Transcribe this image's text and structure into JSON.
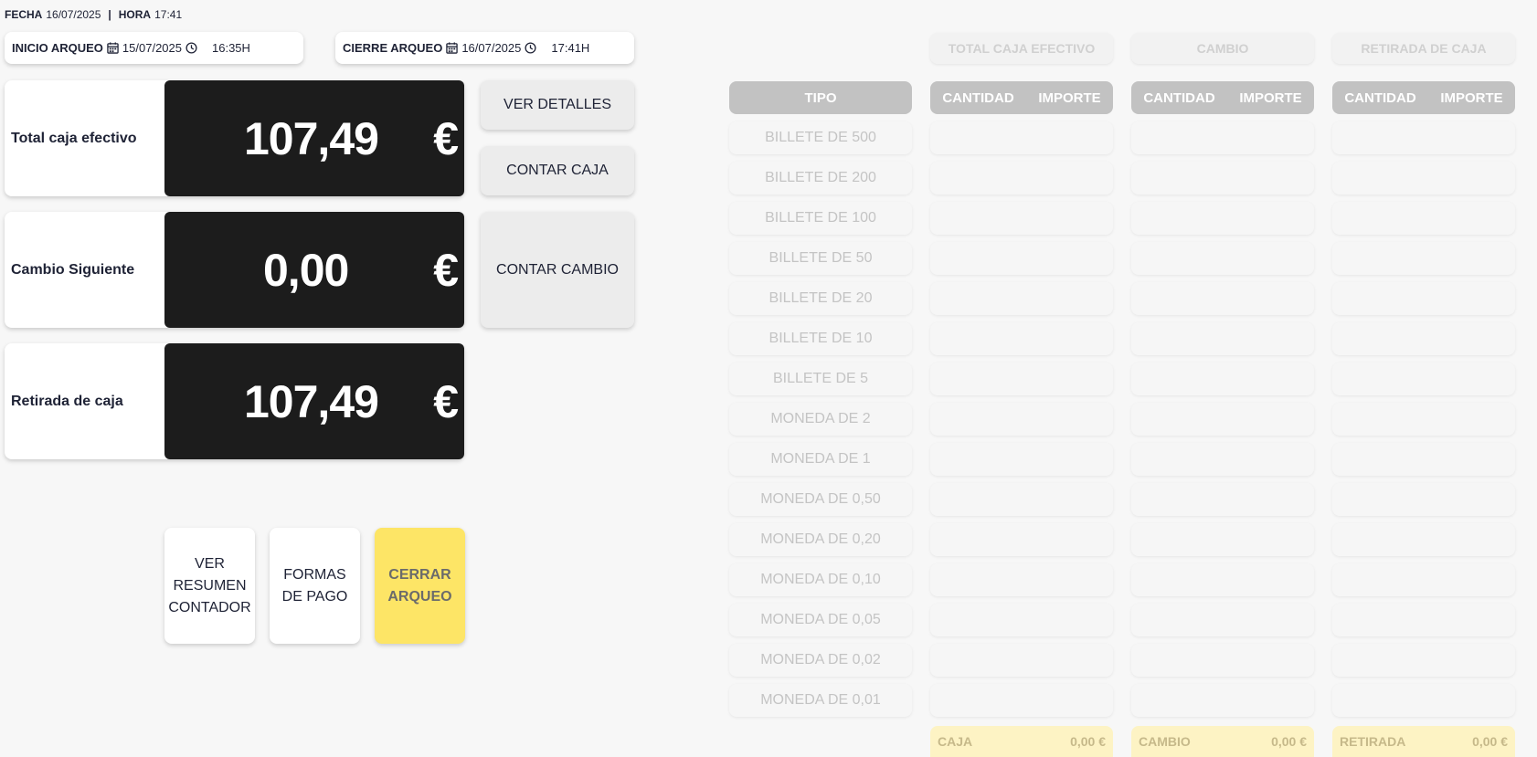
{
  "header": {
    "fecha_label": "FECHA",
    "fecha_value": "16/07/2025",
    "separator": "|",
    "hora_label": "HORA",
    "hora_value": "17:41"
  },
  "inicio": {
    "label": "INICIO ARQUEO",
    "date": "15/07/2025",
    "time": "16:35H"
  },
  "cierre": {
    "label": "CIERRE ARQUEO",
    "date": "16/07/2025",
    "time": "17:41H"
  },
  "stats": [
    {
      "label": "Total caja efectivo",
      "value": "107,49",
      "currency": "€"
    },
    {
      "label": "Cambio Siguiente",
      "value": "0,00",
      "currency": "€"
    },
    {
      "label": "Retirada de caja",
      "value": "107,49",
      "currency": "€"
    }
  ],
  "side_buttons": {
    "ver_detalles": "VER DETALLES",
    "contar_caja": "CONTAR CAJA",
    "contar_cambio": "CONTAR CAMBIO"
  },
  "bottom_buttons": {
    "ver_resumen": "VER RESUMEN CONTADOR",
    "formas_pago": "FORMAS DE PAGO",
    "cerrar_arqueo": "CERRAR ARQUEO"
  },
  "columns": {
    "tipo": "TIPO",
    "total_caja": "TOTAL CAJA EFECTIVO",
    "cambio": "CAMBIO",
    "retirada": "RETIRADA DE CAJA",
    "cantidad": "CANTIDAD",
    "importe": "IMPORTE"
  },
  "tipos": [
    "BILLETE DE 500",
    "BILLETE DE 200",
    "BILLETE DE 100",
    "BILLETE DE 50",
    "BILLETE DE 20",
    "BILLETE DE 10",
    "BILLETE DE 5",
    "MONEDA DE 2",
    "MONEDA DE 1",
    "MONEDA DE 0,50",
    "MONEDA DE 0,20",
    "MONEDA DE 0,10",
    "MONEDA DE 0,05",
    "MONEDA DE 0,02",
    "MONEDA DE 0,01"
  ],
  "totals": {
    "caja_label": "CAJA",
    "caja_value": "0,00 €",
    "cambio_label": "CAMBIO",
    "cambio_value": "0,00 €",
    "retirada_label": "RETIRADA",
    "retirada_value": "0,00 €"
  },
  "colors": {
    "dark_panel": "#1c1c1c",
    "accent_yellow": "#fde566",
    "header_grey": "#c2c2c2"
  }
}
